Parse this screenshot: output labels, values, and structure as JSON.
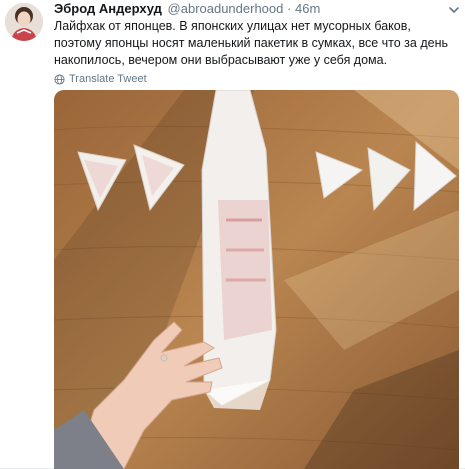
{
  "tweet": {
    "fullname": "Эброд Андерхуд",
    "username": "@abroadunderhood",
    "separator": "·",
    "time": "46m",
    "text": "Лайфхак от японцев. В японских улицах нет мусорных баков, поэтому японцы носят маленький пакетик в сумках, все что за день накопилось, вечером они выбрасывают уже у себя дома.",
    "translate_label": "Translate Tweet"
  },
  "icons": {
    "more": "chevron-down-icon",
    "translate": "globe-icon",
    "avatar": "user-avatar"
  },
  "colors": {
    "link": "#1da1f2",
    "secondary": "#657786",
    "text": "#14171a",
    "wood": "#b07a46"
  },
  "photo": {
    "description_free": true,
    "printed_text": ""
  }
}
